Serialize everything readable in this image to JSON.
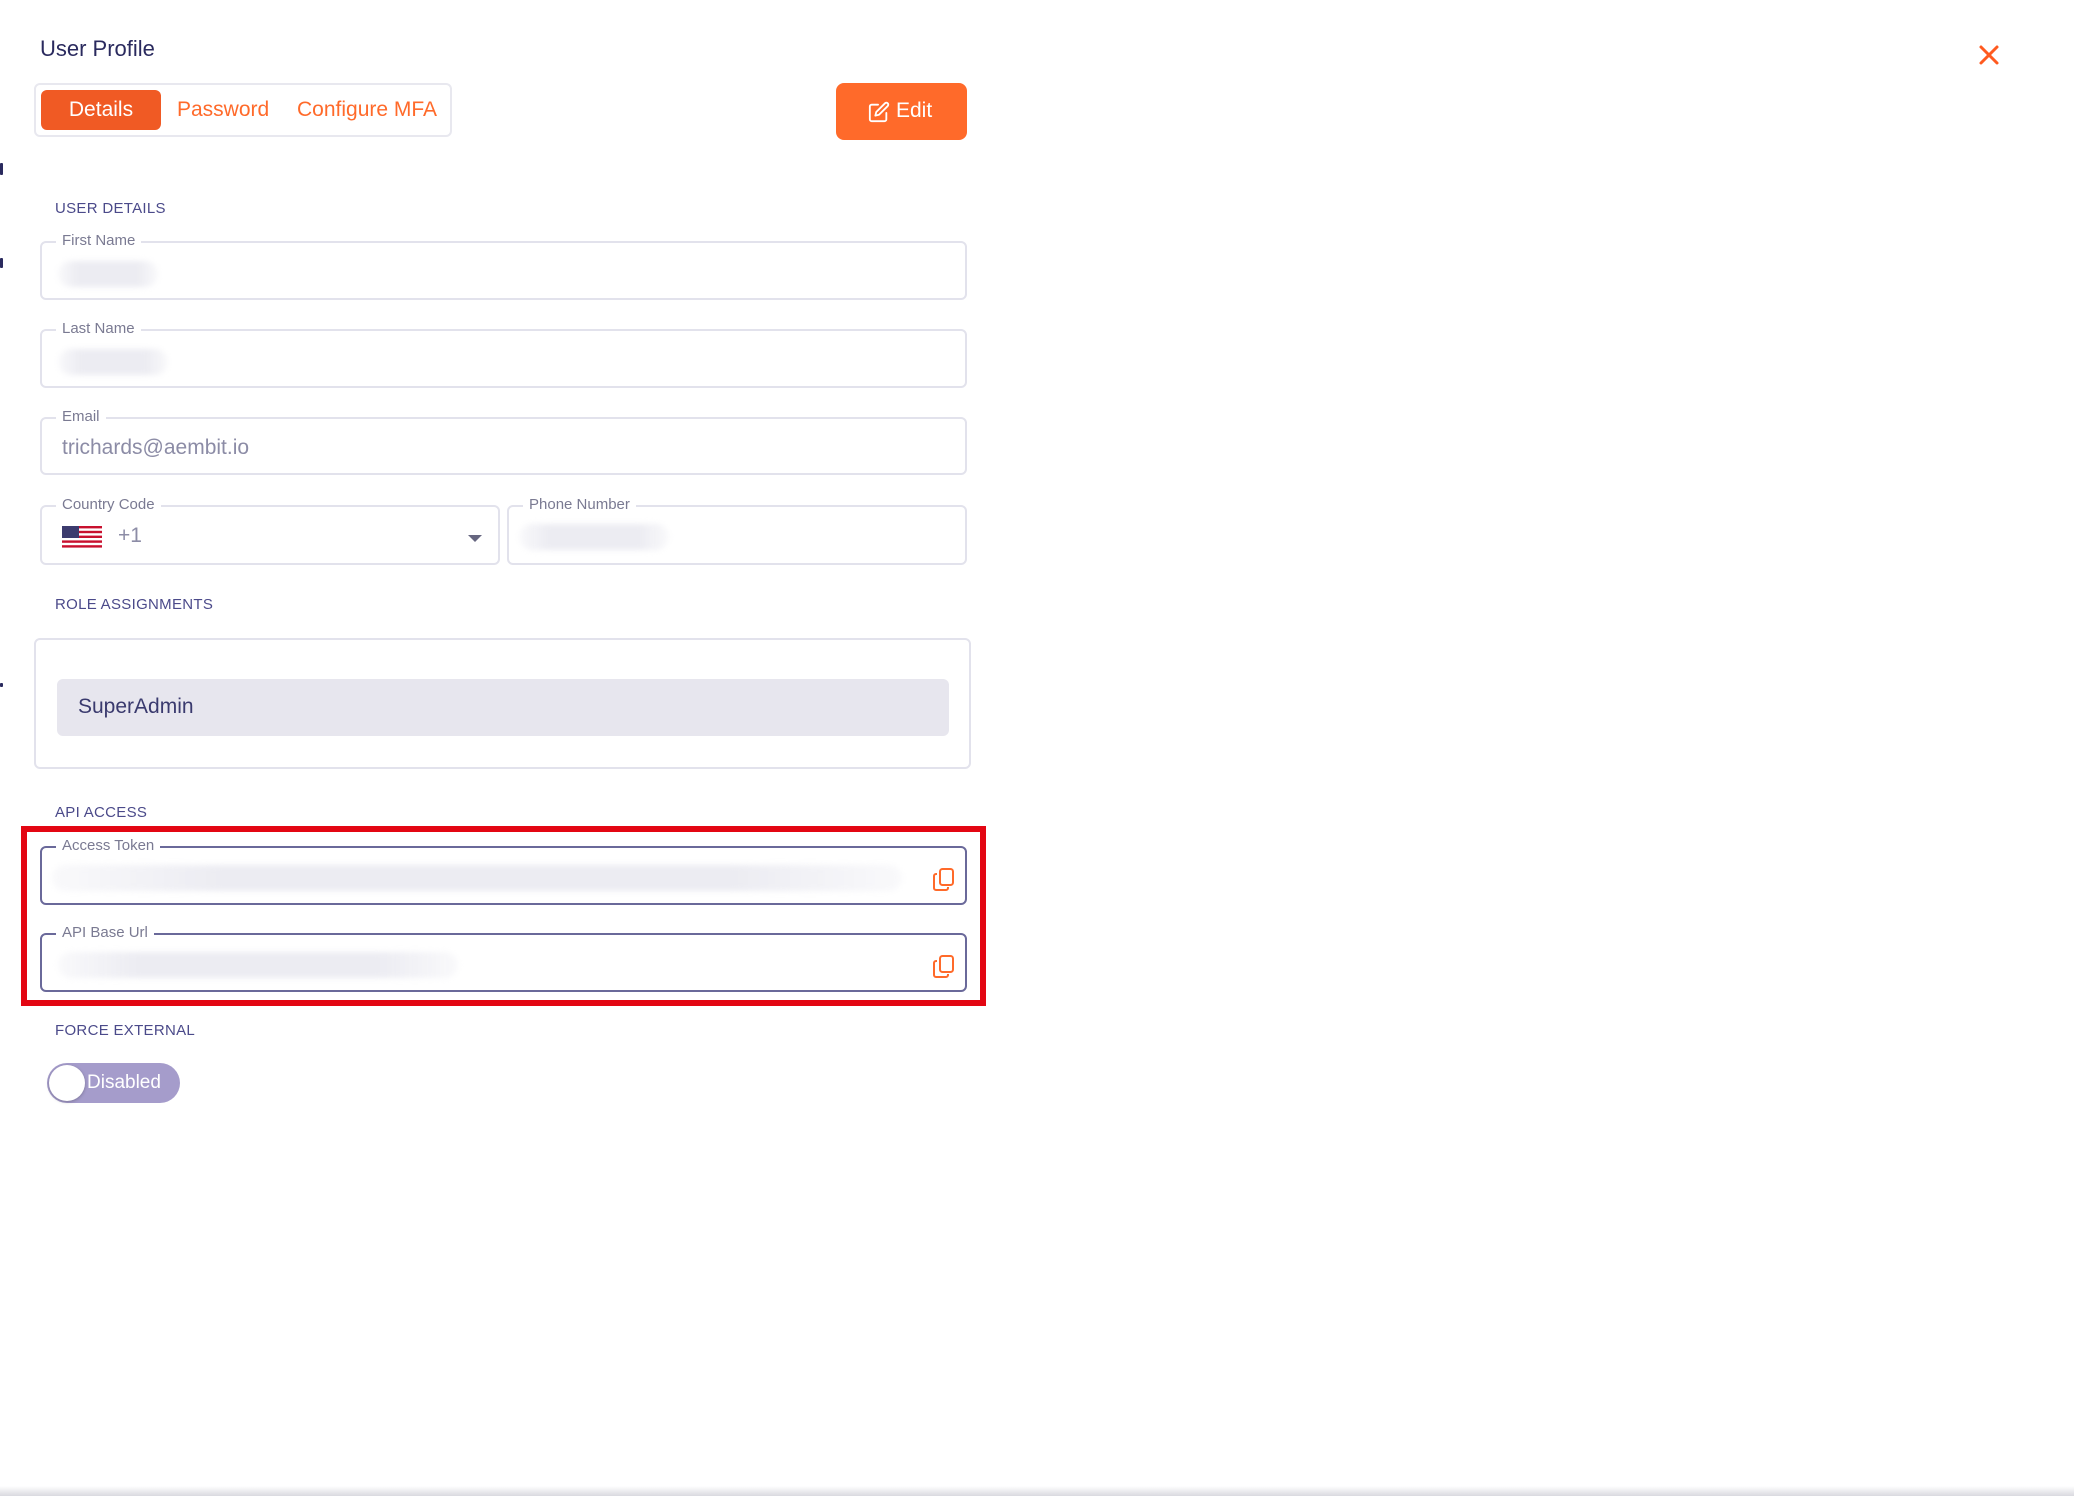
{
  "header": {
    "title": "User Profile",
    "close_icon": "close-icon"
  },
  "tabs": [
    {
      "label": "Details",
      "active": true
    },
    {
      "label": "Password",
      "active": false
    },
    {
      "label": "Configure MFA",
      "active": false
    }
  ],
  "toolbar": {
    "edit_label": "Edit",
    "edit_icon": "edit-icon"
  },
  "user_details": {
    "section_label": "USER DETAILS",
    "first_name": {
      "label": "First Name",
      "value_redacted": true
    },
    "last_name": {
      "label": "Last Name",
      "value_redacted": true
    },
    "email": {
      "label": "Email",
      "value": "trichards@aembit.io"
    },
    "country_code": {
      "label": "Country Code",
      "flag_icon": "us-flag-icon",
      "value": "+1"
    },
    "phone_number": {
      "label": "Phone Number",
      "value_redacted": true
    }
  },
  "role_assignments": {
    "section_label": "ROLE ASSIGNMENTS",
    "roles": [
      "SuperAdmin"
    ]
  },
  "api_access": {
    "section_label": "API ACCESS",
    "access_token": {
      "label": "Access Token",
      "value_redacted": true,
      "copy_icon": "copy-icon"
    },
    "api_base_url": {
      "label": "API Base Url",
      "value_redacted": true,
      "copy_icon": "copy-icon"
    }
  },
  "force_external": {
    "section_label": "FORCE EXTERNAL",
    "toggle_label": "Disabled",
    "enabled": false
  },
  "colors": {
    "accent": "#ff6a2a",
    "active_tab": "#f05a24",
    "highlight": "#e30613",
    "section_label": "#4b4a8a",
    "toggle_off": "#a59ccb",
    "role_chip": "#e7e6ee"
  }
}
